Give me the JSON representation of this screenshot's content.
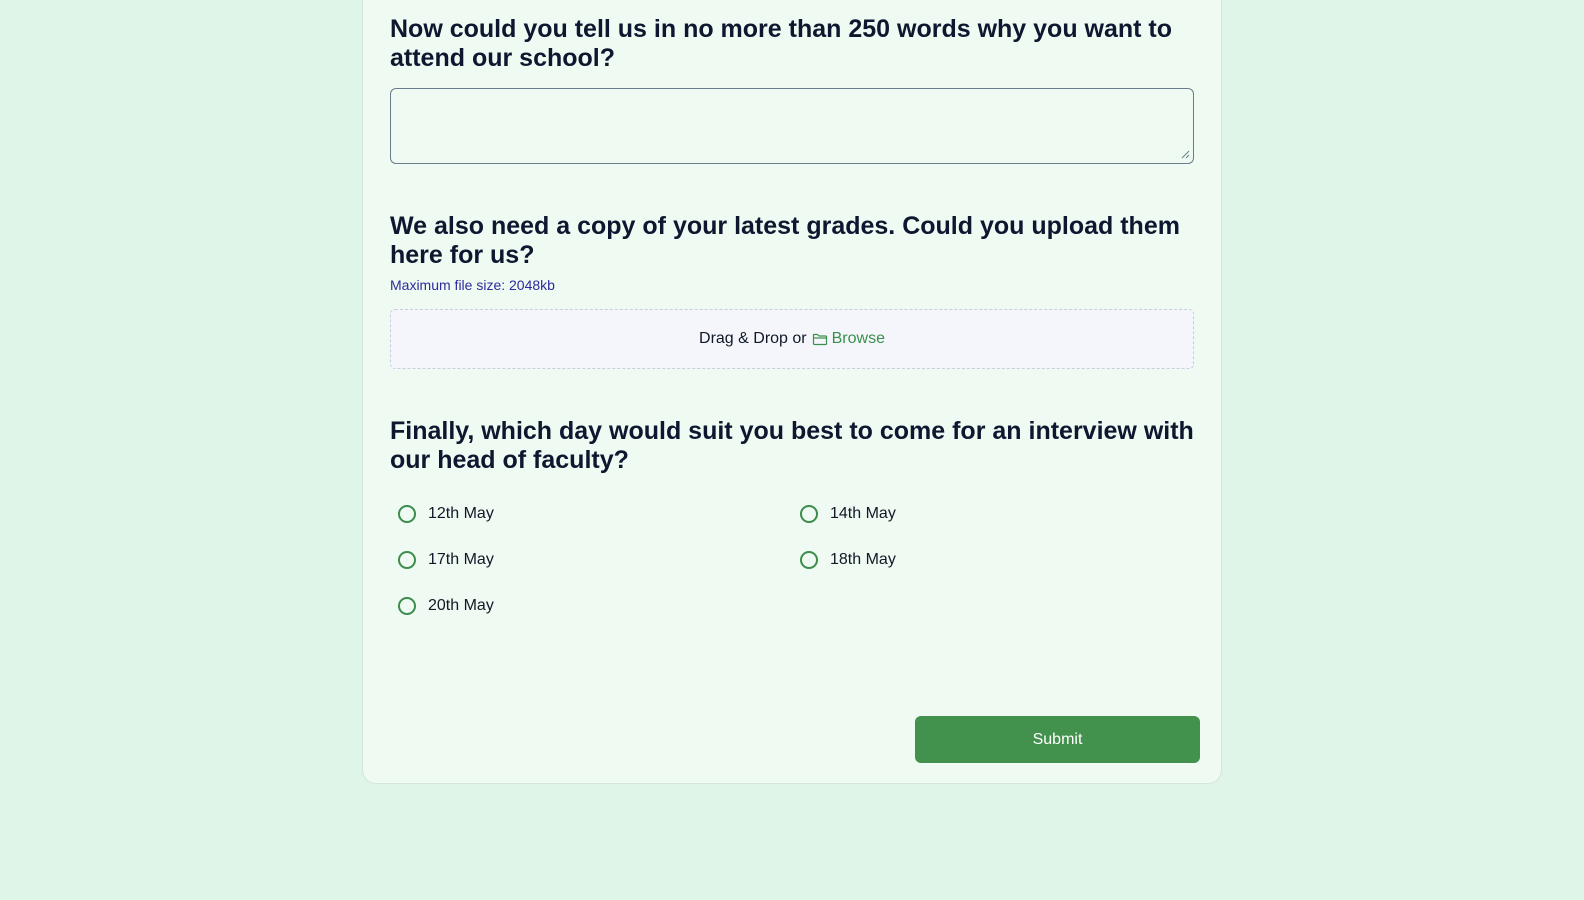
{
  "reason_section": {
    "title": "Now could you tell us in no more than 250 words why you want to attend our school?",
    "value": "",
    "placeholder": ""
  },
  "grades_section": {
    "title": "We also need a copy of your latest grades. Could you upload them here for us?",
    "hint": "Maximum file size: 2048kb",
    "dropzone_text": "Drag & Drop or",
    "browse_label": "Browse",
    "browse_icon": "folder-icon"
  },
  "interview_section": {
    "title": "Finally, which day would suit you best to come for an interview with our head of faculty?",
    "options": [
      {
        "label": "12th May"
      },
      {
        "label": "14th May"
      },
      {
        "label": "17th May"
      },
      {
        "label": "18th May"
      },
      {
        "label": "20th May"
      }
    ]
  },
  "submit_label": "Submit",
  "colors": {
    "page_background": "#dff5e8",
    "card_background": "#eefaf2",
    "accent_green": "#42914c",
    "hint_text": "#2f2a9e",
    "heading_text": "#0f1630"
  }
}
